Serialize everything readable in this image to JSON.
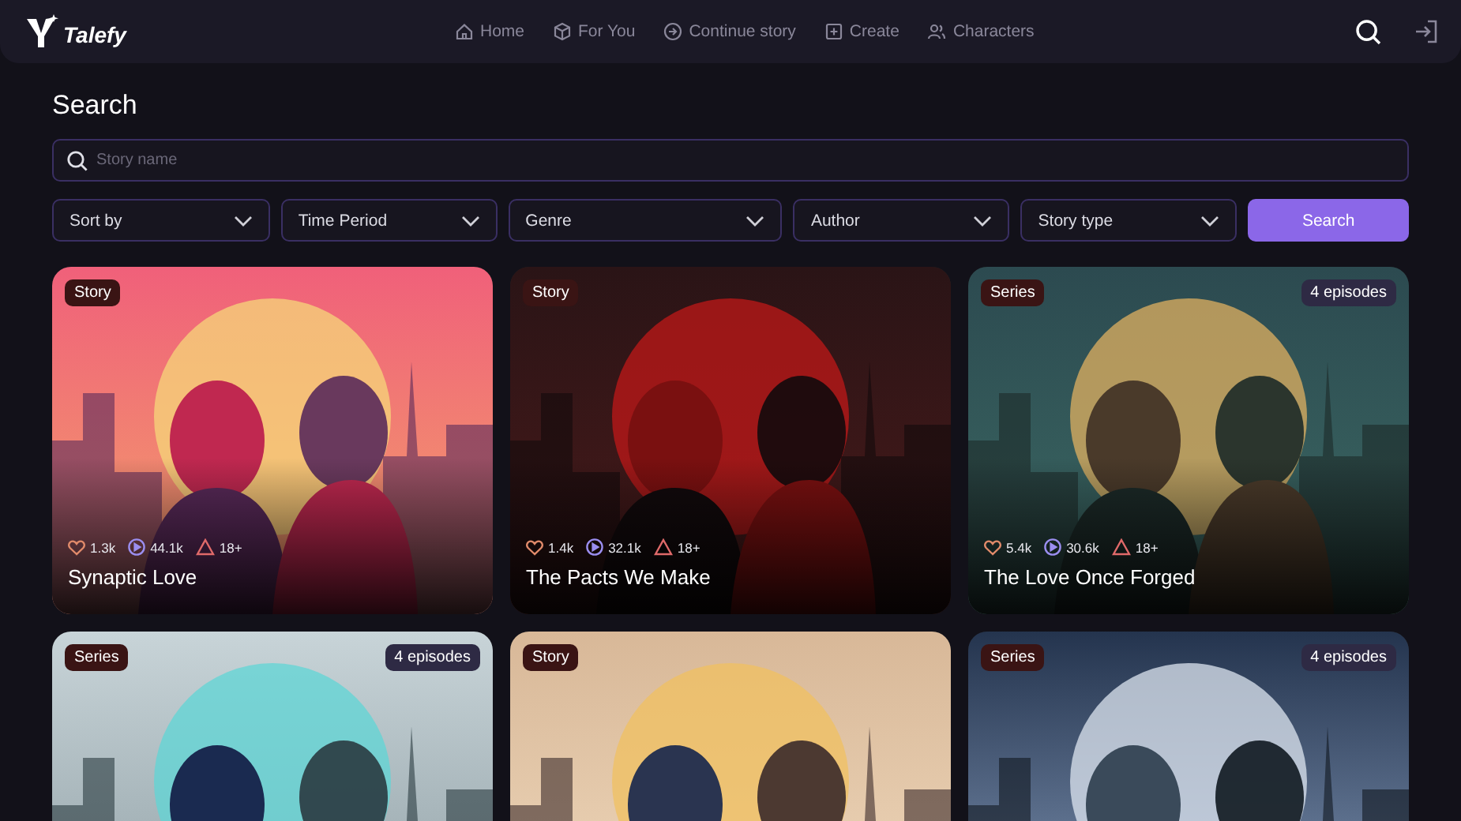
{
  "brand": "Talefy",
  "nav": [
    "Home",
    "For You",
    "Continue story",
    "Create",
    "Characters"
  ],
  "page_title": "Search",
  "search": {
    "placeholder": "Story name"
  },
  "filters": [
    "Sort by",
    "Time Period",
    "Genre",
    "Author",
    "Story type"
  ],
  "search_button": "Search",
  "cards": [
    {
      "type": "Story",
      "title": "Synaptic Love",
      "likes": "1.3k",
      "plays": "44.1k",
      "rating": "18+"
    },
    {
      "type": "Story",
      "title": "The Pacts We Make",
      "likes": "1.4k",
      "plays": "32.1k",
      "rating": "18+"
    },
    {
      "type": "Series",
      "episodes": "4 episodes",
      "title": "The Love Once Forged",
      "likes": "5.4k",
      "plays": "30.6k",
      "rating": "18+"
    },
    {
      "type": "Series",
      "episodes": "4 episodes"
    },
    {
      "type": "Story"
    },
    {
      "type": "Series",
      "episodes": "4 episodes"
    }
  ]
}
